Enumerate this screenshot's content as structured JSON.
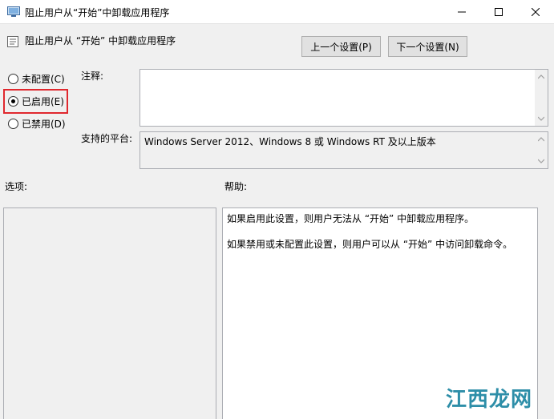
{
  "window": {
    "title": "阻止用户从“开始”中卸载应用程序"
  },
  "header": {
    "policy_title": "阻止用户从 “开始” 中卸载应用程序",
    "prev_button": "上一个设置(P)",
    "next_button": "下一个设置(N)"
  },
  "state": {
    "options": [
      {
        "label": "未配置(C)",
        "checked": false
      },
      {
        "label": "已启用(E)",
        "checked": true
      },
      {
        "label": "已禁用(D)",
        "checked": false
      }
    ]
  },
  "fields": {
    "comment_label": "注释:",
    "comment_value": "",
    "platform_label": "支持的平台:",
    "platform_value": "Windows Server 2012、Windows 8 或 Windows RT 及以上版本"
  },
  "panels": {
    "options_label": "选项:",
    "help_label": "帮助:",
    "help_lines": [
      "如果启用此设置，则用户无法从 “开始” 中卸载应用程序。",
      "如果禁用或未配置此设置，则用户可以从 “开始” 中访问卸载命令。"
    ]
  },
  "watermark": {
    "text": "江西龙网"
  },
  "colors": {
    "highlight": "#e0282e",
    "watermark": "#2d8ea8"
  }
}
